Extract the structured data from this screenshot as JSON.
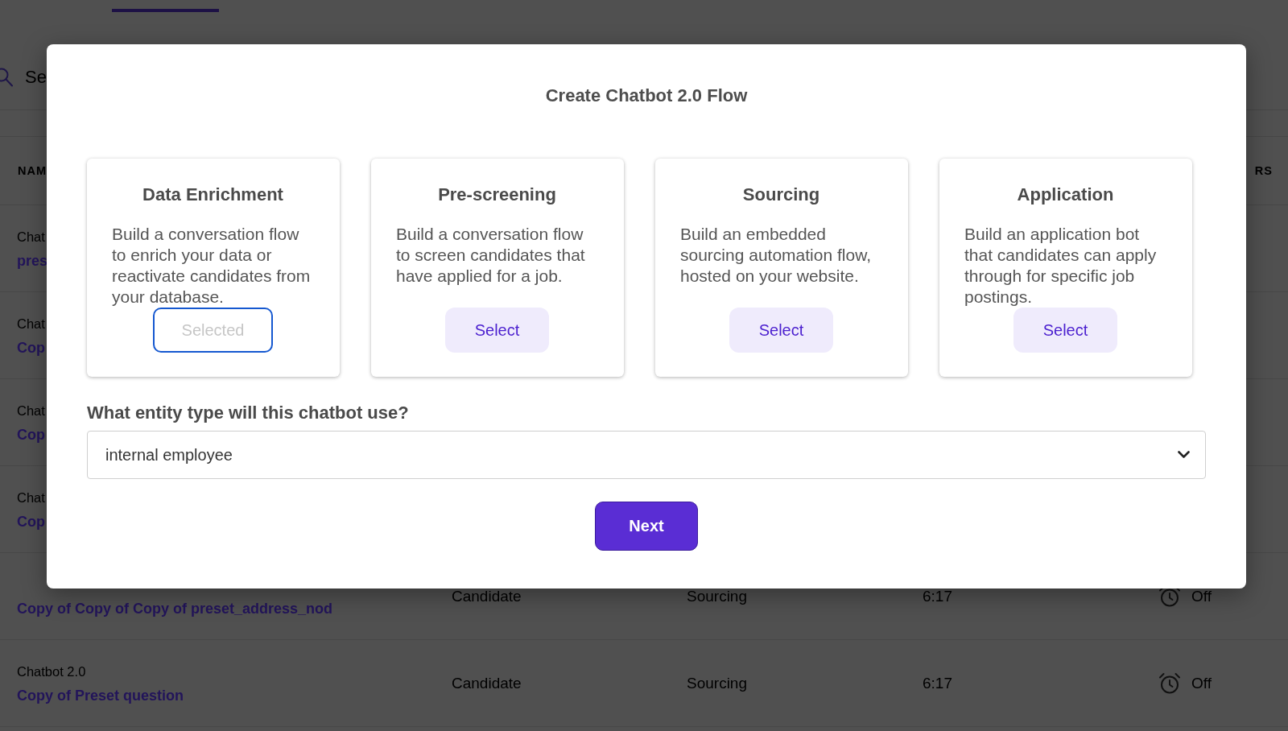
{
  "nav": {
    "tab_underline": true
  },
  "search": {
    "placeholder": "Se"
  },
  "table": {
    "columns": [
      "NAM",
      "RS"
    ],
    "rows": [
      {
        "label": "Chat",
        "name": "pres"
      },
      {
        "label": "Chat",
        "name": "Cop"
      },
      {
        "label": "Chat",
        "name": "Cop"
      },
      {
        "label": "Chat",
        "name": "Cop"
      },
      {
        "name": "Copy of Copy of Copy of preset_address_nod",
        "column_2": "Candidate",
        "column_3": "Sourcing",
        "column_4": "6:17",
        "column_5": "Off"
      },
      {
        "label": "Chatbot 2.0",
        "name": "Copy of Preset question",
        "column_2": "Candidate",
        "column_3": "Sourcing",
        "column_4": "6:17",
        "column_5": "Off"
      }
    ]
  },
  "dialog": {
    "title": "Create Chatbot 2.0 Flow",
    "cards": [
      {
        "title": "Data Enrichment",
        "description": "Build a conversation flow to enrich your data or reactivate candidates from your database.",
        "button": "Selected",
        "selected": true
      },
      {
        "title": "Pre-screening",
        "description": "Build a conversation flow to screen candidates that have applied for a job.",
        "button": "Select",
        "selected": false
      },
      {
        "title": "Sourcing",
        "description": "Build an embedded sourcing automation flow, hosted on your website.",
        "button": "Select",
        "selected": false
      },
      {
        "title": "Application",
        "description": "Build an application bot that candidates can apply through for specific job postings.",
        "button": "Select",
        "selected": false
      }
    ],
    "entity_question": "What entity type will this chatbot use?",
    "entity_select": {
      "value": "internal employee"
    },
    "next_button": "Next"
  }
}
